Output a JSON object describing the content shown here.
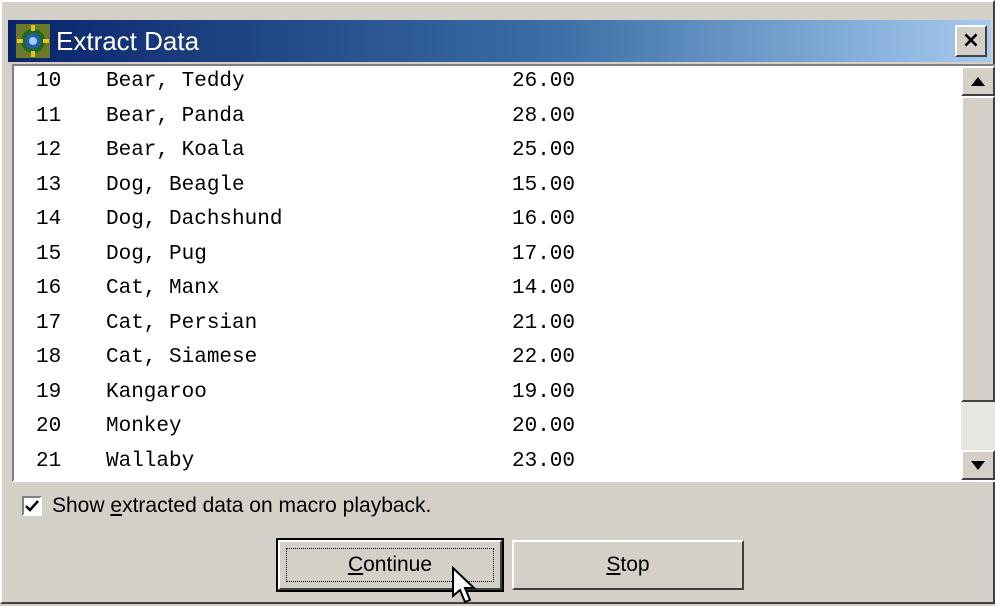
{
  "window": {
    "title": "Extract Data",
    "close_label": "×"
  },
  "list": {
    "rows": [
      {
        "id": "10",
        "name": "Bear, Teddy",
        "price": "26.00"
      },
      {
        "id": "11",
        "name": "Bear, Panda",
        "price": "28.00"
      },
      {
        "id": "12",
        "name": "Bear, Koala",
        "price": "25.00"
      },
      {
        "id": "13",
        "name": "Dog, Beagle",
        "price": "15.00"
      },
      {
        "id": "14",
        "name": "Dog, Dachshund",
        "price": "16.00"
      },
      {
        "id": "15",
        "name": "Dog, Pug",
        "price": "17.00"
      },
      {
        "id": "16",
        "name": "Cat, Manx",
        "price": "14.00"
      },
      {
        "id": "17",
        "name": "Cat, Persian",
        "price": "21.00"
      },
      {
        "id": "18",
        "name": "Cat, Siamese",
        "price": "22.00"
      },
      {
        "id": "19",
        "name": "Kangaroo",
        "price": "19.00"
      },
      {
        "id": "20",
        "name": "Monkey",
        "price": "20.00"
      },
      {
        "id": "21",
        "name": "Wallaby",
        "price": "23.00"
      }
    ]
  },
  "options": {
    "show_extracted": {
      "checked": true,
      "label_prefix": "Show ",
      "label_mnemonic": "e",
      "label_suffix": "xtracted data on macro playback."
    }
  },
  "buttons": {
    "continue_mnemonic": "C",
    "continue_rest": "ontinue",
    "stop_mnemonic": "S",
    "stop_rest": "top"
  },
  "icons": {
    "app": "app-icon",
    "close": "close-icon",
    "scroll_up": "arrow-up-icon",
    "scroll_down": "arrow-down-icon",
    "checkmark": "checkmark-icon",
    "cursor": "mouse-pointer-icon"
  },
  "colors": {
    "title_bar_start": "#0a246a",
    "title_bar_end": "#a6caf0",
    "face": "#d4d0c8"
  }
}
